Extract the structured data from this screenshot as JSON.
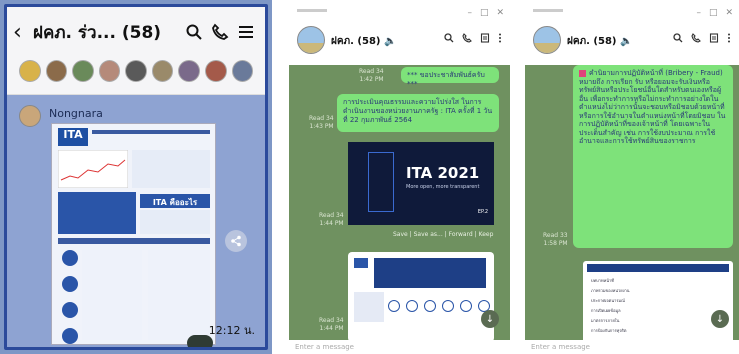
{
  "panel1": {
    "title": "ฝคภ. ร่ว... (58)",
    "sender": "Nongnara",
    "time": "12:12 น.",
    "poster_heading": "ITA",
    "poster_banner": "ITA คืออะไร"
  },
  "panel2": {
    "chat_name": "ฝคภ. (58)",
    "msg1": "*** ขอประชาสัมพันธ์ครับ ***",
    "msg1_read": "Read 34",
    "msg1_time": "1:42 PM",
    "msg2": "การประเมินคุณธรรมและความโปร่งใส ในการดำเนินงานของหน่วยงานภาครัฐ : ITA ครั้งที่ 1 วันที่ 22 กุมภาพันธ์ 2564",
    "msg2_read": "Read 34",
    "msg2_time": "1:43 PM",
    "ita_title": "ITA 2021",
    "ita_sub": "More open, more transparent",
    "ita_ep": "EP.2",
    "img_read": "Read 34",
    "img_time": "1:44 PM",
    "act_save": "Save",
    "act_saveas": "Save as...",
    "act_forward": "Forward",
    "act_keep": "Keep",
    "card_read": "Read 34",
    "card_time": "1:44 PM",
    "input_placeholder": "Enter a message"
  },
  "panel3": {
    "chat_name": "ฝคภ. (58)",
    "long_msg": "คำนิยามการปฏิบัติหน้าที่ (Bribery - Fraud) หมายถึง การเรียก รับ หรือยอมจะรับเงินหรือทรัพย์สินหรือประโยชน์อื่นใดสำหรับตนเองหรือผู้อื่น เพื่อกระทำการหรือไม่กระทำการอย่างใดในตำแหน่งไม่ว่าการนั้นจะชอบหรือมิชอบด้วยหน้าที่ หรือการใช้อำนาจในตำแหน่งหน้าที่โดยมิชอบ ในการปฏิบัติหน้าที่ของเจ้าหน้าที่ โดยเฉพาะในประเด็นสำคัญ เช่น การใช้งบประมาณ การใช้อำนาจและการใช้ทรัพย์สินของราชการ",
    "long_read": "Read 33",
    "long_time": "1:58 PM",
    "doc_rows": [
      "บทบาทหน้าที่",
      "ภาพรวมของหน่วยงาน",
      "ประกาศเจตนารมณ์",
      "การเปิดเผยข้อมูล",
      "มาตรการภายใน",
      "การป้องกันการทุจริต"
    ],
    "input_placeholder": "Enter a message"
  },
  "colors": {
    "line_green": "#7ee27a",
    "chat_bg": "#6f9160",
    "mobile_bg": "#8ea3d2"
  }
}
